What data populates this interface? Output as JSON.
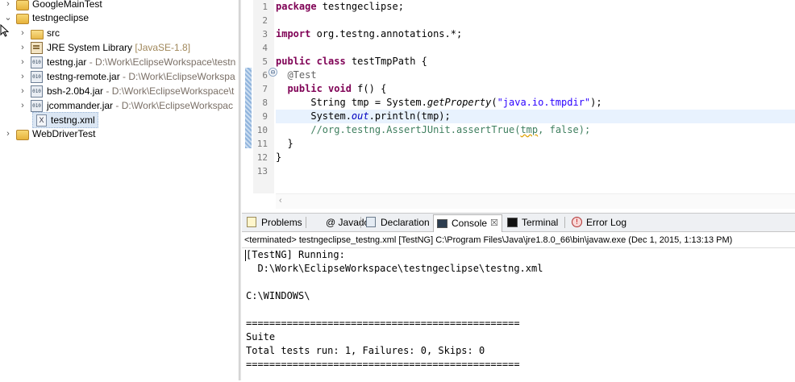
{
  "explorer": {
    "items": [
      {
        "label": "GoogleMainTest",
        "decoration": "",
        "twisty": "›",
        "icon": "project-icon"
      },
      {
        "label": "testngeclipse",
        "decoration": "",
        "twisty": "⌄",
        "icon": "project-icon"
      },
      {
        "label": "src",
        "decoration": "",
        "twisty": "›",
        "icon": "source-folder-icon"
      },
      {
        "label": "JRE System Library",
        "decoration": "[JavaSE-1.8]",
        "twisty": "›",
        "icon": "library-icon"
      },
      {
        "label": "testng.jar",
        "decoration": " - D:\\Work\\EclipseWorkspace\\testn",
        "twisty": "›",
        "icon": "jar-icon",
        "icon_text": "010"
      },
      {
        "label": "testng-remote.jar",
        "decoration": " - D:\\Work\\EclipseWorkspa",
        "twisty": "›",
        "icon": "jar-icon",
        "icon_text": "010"
      },
      {
        "label": "bsh-2.0b4.jar",
        "decoration": " - D:\\Work\\EclipseWorkspace\\t",
        "twisty": "›",
        "icon": "jar-icon",
        "icon_text": "010"
      },
      {
        "label": "jcommander.jar",
        "decoration": " - D:\\Work\\EclipseWorkspac",
        "twisty": "›",
        "icon": "jar-icon",
        "icon_text": "010"
      },
      {
        "label": "testng.xml",
        "decoration": "",
        "twisty": "",
        "icon": "xml-file-icon",
        "icon_text": "X"
      },
      {
        "label": "WebDriverTest",
        "decoration": "",
        "twisty": "›",
        "icon": "project-icon"
      }
    ]
  },
  "editor": {
    "line_numbers": [
      "1",
      "2",
      "3",
      "4",
      "5",
      "6",
      "7",
      "8",
      "9",
      "10",
      "11",
      "12",
      "13"
    ],
    "fold_marker": "⊖",
    "scroll_left": "‹",
    "lines": [
      [
        {
          "t": "package",
          "c": "kw"
        },
        {
          "t": " testngeclipse;",
          "c": ""
        }
      ],
      [],
      [
        {
          "t": "import",
          "c": "kw"
        },
        {
          "t": " org.testng.annotations.*;",
          "c": ""
        }
      ],
      [],
      [
        {
          "t": "public",
          "c": "kw"
        },
        {
          "t": " ",
          "c": ""
        },
        {
          "t": "class",
          "c": "kw"
        },
        {
          "t": " testTmpPath {",
          "c": ""
        }
      ],
      [
        {
          "t": "  ",
          "c": ""
        },
        {
          "t": "@Test",
          "c": "ann"
        }
      ],
      [
        {
          "t": "  ",
          "c": ""
        },
        {
          "t": "public",
          "c": "kw"
        },
        {
          "t": " ",
          "c": ""
        },
        {
          "t": "void",
          "c": "kw"
        },
        {
          "t": " f() {",
          "c": ""
        }
      ],
      [
        {
          "t": "      String tmp = System.",
          "c": ""
        },
        {
          "t": "getProperty",
          "c": "mth"
        },
        {
          "t": "(",
          "c": ""
        },
        {
          "t": "\"java.io.tmpdir\"",
          "c": "str"
        },
        {
          "t": ");",
          "c": ""
        }
      ],
      [
        {
          "t": "      System.",
          "c": ""
        },
        {
          "t": "out",
          "c": "fld"
        },
        {
          "t": ".println(tmp);",
          "c": ""
        }
      ],
      [
        {
          "t": "      ",
          "c": ""
        },
        {
          "t": "//org.testng.AssertJUnit.assertTrue(",
          "c": "cm"
        },
        {
          "t": "tmp",
          "c": "cm sq"
        },
        {
          "t": ", false);",
          "c": "cm"
        }
      ],
      [
        {
          "t": "  }",
          "c": ""
        }
      ],
      [
        {
          "t": "}",
          "c": ""
        }
      ],
      []
    ],
    "current_line_index": 8
  },
  "views": {
    "tabs": [
      {
        "label": "Problems",
        "icon": "problems-icon"
      },
      {
        "label": "@ Javadoc",
        "icon": "javadoc-icon"
      },
      {
        "label": "Declaration",
        "icon": "declaration-icon"
      },
      {
        "label": "Console",
        "icon": "console-icon",
        "active": true,
        "close": "☒"
      },
      {
        "label": "Terminal",
        "icon": "terminal-icon"
      },
      {
        "label": "Error Log",
        "icon": "error-log-icon"
      }
    ],
    "console_header": "<terminated> testngeclipse_testng.xml [TestNG] C:\\Program Files\\Java\\jre1.8.0_66\\bin\\javaw.exe (Dec 1, 2015, 1:13:13 PM)",
    "console_lines": [
      "[TestNG] Running:",
      "  D:\\Work\\EclipseWorkspace\\testngeclipse\\testng.xml",
      "",
      "C:\\WINDOWS\\",
      "",
      "===============================================",
      "Suite",
      "Total tests run: 1, Failures: 0, Skips: 0",
      "==============================================="
    ]
  }
}
